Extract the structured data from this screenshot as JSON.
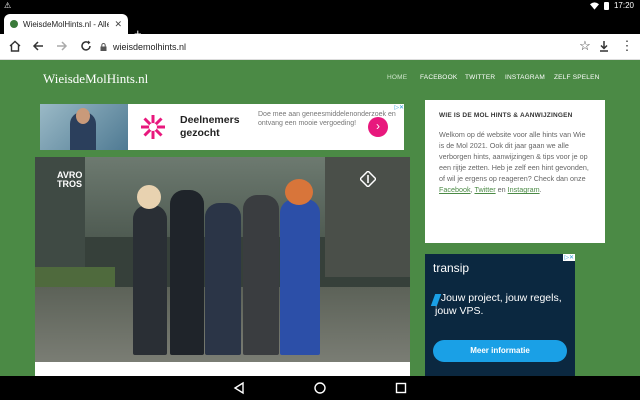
{
  "status_bar": {
    "time": "17:20"
  },
  "browser": {
    "tab_title": "WieisdeMolHints.nl - Alle hints",
    "url": "wieisdemolhints.nl"
  },
  "site": {
    "title": "WieisdeMolHints.nl",
    "nav": [
      "HOME",
      "FACEBOOK",
      "TWITTER",
      "INSTAGRAM",
      "ZELF SPELEN"
    ]
  },
  "ad_banner": {
    "headline": "Deelnemers gezocht",
    "body": "Doe mee aan geneesmiddelenonderzoek en ontvang een mooie vergoeding!",
    "go_symbol": "›"
  },
  "video": {
    "badge_line1": "AVRO",
    "badge_line2": "TROS"
  },
  "sidebar": {
    "heading": "WIE IS DE MOL HINTS & AANWIJZINGEN",
    "text_before": "Welkom op dé website voor alle hints van Wie is de Mol 2021. Ook dit jaar gaan we alle verborgen hints, aanwijzingen & tips voor je op een rijtje zetten. Heb je zelf een hint gevonden, of wil je ergens op reageren? Check dan onze ",
    "link_facebook": "Facebook",
    "sep1": ", ",
    "link_twitter": "Twitter",
    "sep2": " en ",
    "link_instagram": "Instagram",
    "text_after": "."
  },
  "side_ad": {
    "brand_main": "trans",
    "brand_suffix": "ip",
    "tagline": "Jouw project, jouw regels, jouw VPS.",
    "cta": "Meer informatie"
  },
  "colors": {
    "page_green": "#4b8a45",
    "cta_pink": "#e8187d",
    "cta_blue": "#1aa0e6",
    "ad_dark": "#0b2840"
  }
}
